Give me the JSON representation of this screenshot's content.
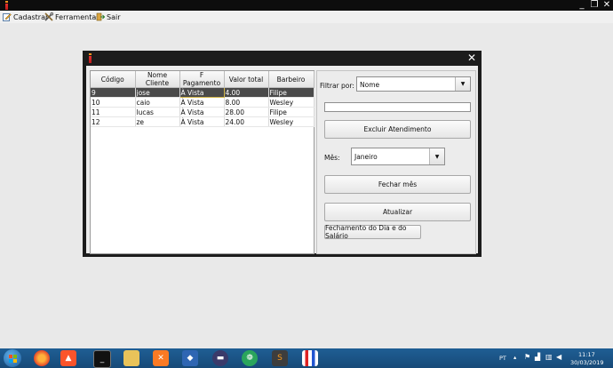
{
  "window": {
    "minimize": "_",
    "restore": "❐",
    "close": "✕"
  },
  "menu": {
    "items": [
      {
        "label": "Cadastrar",
        "icon": "edit-icon"
      },
      {
        "label": "Ferramentas",
        "icon": "tools-icon"
      },
      {
        "label": "Sair",
        "icon": "exit-icon"
      }
    ]
  },
  "dialog": {
    "close": "✕"
  },
  "table": {
    "headers": [
      "Código",
      "Nome Cliente",
      "F Pagamento",
      "Valor total",
      "Barbeiro"
    ],
    "rows": [
      [
        "9",
        "jose",
        "À Vista",
        "4.00",
        "Filipe"
      ],
      [
        "10",
        "caio",
        "À Vista",
        "8.00",
        "Wesley"
      ],
      [
        "11",
        "lucas",
        "À Vista",
        "28.00",
        "Filipe"
      ],
      [
        "12",
        "ze",
        "À Vista",
        "24.00",
        "Wesley"
      ]
    ],
    "selected_row": 0
  },
  "panel": {
    "filter_label": "Filtrar por:",
    "filter_value": "Nome",
    "search_value": "",
    "delete_button": "Excluir Atendimento",
    "month_label": "Mês:",
    "month_value": "Janeiro",
    "close_month_button": "Fechar mês",
    "update_button": "Atualizar",
    "day_close_button": "Fechamento do Dia e do Salário"
  },
  "taskbar": {
    "language": "PT",
    "time": "11:17",
    "date": "30/03/2019",
    "apps": [
      "explorer-icon",
      "firefox-icon",
      "brave-icon",
      "terminal-icon",
      "files-icon",
      "xampp-icon",
      "virtualbox-icon",
      "media-icon",
      "app-icon",
      "sublime-icon",
      "barber-app-icon"
    ]
  },
  "colors": {
    "selected_row": "#4a4a4a",
    "taskbar": "#1f5e94",
    "titlebar": "#0d0d0d"
  }
}
